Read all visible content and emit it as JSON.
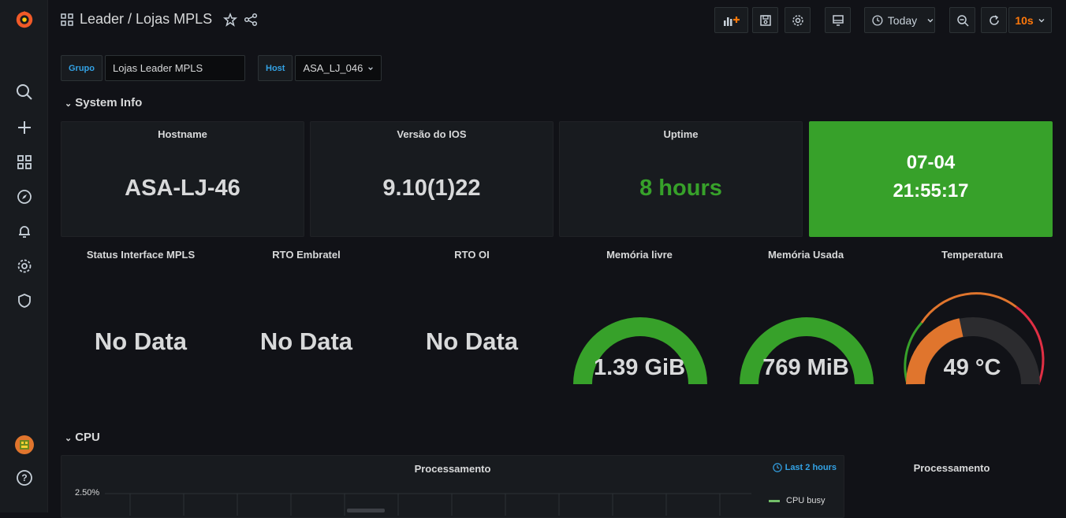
{
  "dashboard": {
    "title": "Leader / Lojas MPLS",
    "time_picker": "Today",
    "refresh_interval": "10s"
  },
  "variables": [
    {
      "label": "Grupo",
      "value": "Lojas Leader MPLS"
    },
    {
      "label": "Host",
      "value": "ASA_LJ_046"
    }
  ],
  "rows": {
    "system_info": "System Info",
    "cpu": "CPU"
  },
  "stat_panels": [
    {
      "title": "Hostname",
      "value": "ASA-LJ-46"
    },
    {
      "title": "Versão do IOS",
      "value": "9.10(1)22"
    },
    {
      "title": "Uptime",
      "value": "8 hours"
    },
    {
      "title": "",
      "value_line1": "07-04",
      "value_line2": "21:55:17"
    }
  ],
  "status_panels": [
    {
      "title": "Status Interface MPLS",
      "value": "No Data"
    },
    {
      "title": "RTO Embratel",
      "value": "No Data"
    },
    {
      "title": "RTO OI",
      "value": "No Data"
    }
  ],
  "gauges": [
    {
      "title": "Memória livre",
      "value": "1.39 GiB",
      "fill": 1.0,
      "color": "#37a12a"
    },
    {
      "title": "Memória Usada",
      "value": "769 MiB",
      "fill": 1.0,
      "color": "#37a12a"
    },
    {
      "title": "Temperatura",
      "value": "49 °C",
      "fill": 0.4,
      "color": "#e0752d"
    }
  ],
  "cpu_panels": {
    "graph_title": "Processamento",
    "time_info": "Last 2 hours",
    "y_tick": "2.50%",
    "legend": "CPU busy",
    "side_title": "Processamento"
  },
  "colors": {
    "green": "#37a12a",
    "green_text": "#37a12a",
    "accent_orange": "#ff780a",
    "link_blue": "#33a2e5"
  }
}
